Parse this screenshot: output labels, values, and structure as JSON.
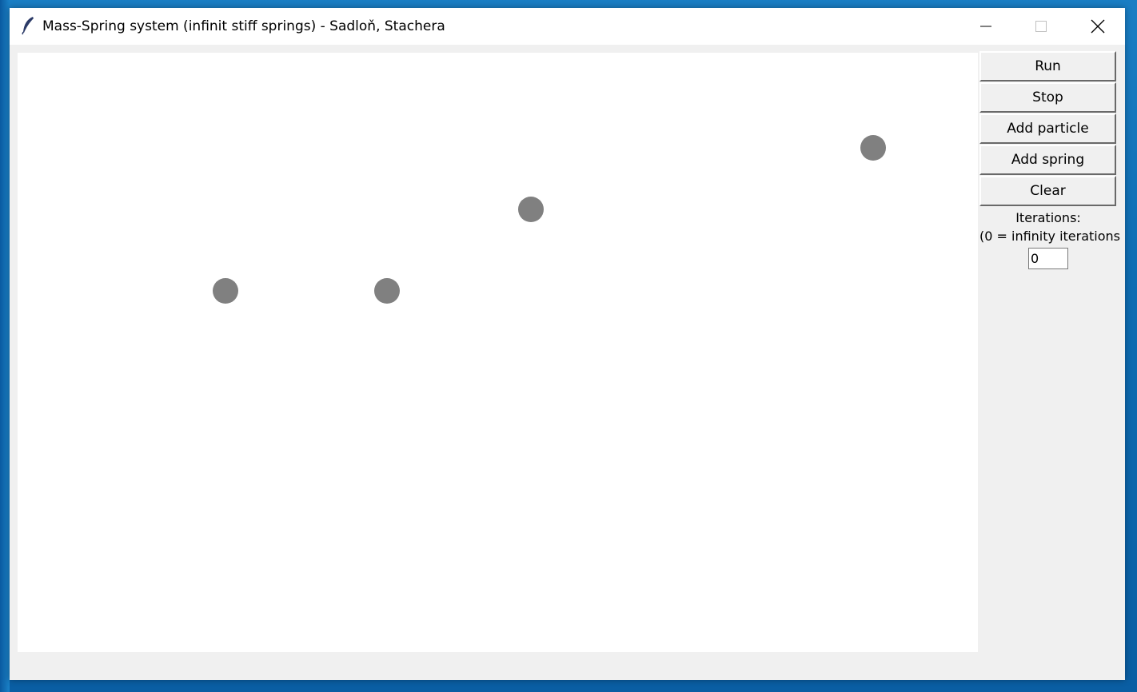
{
  "window": {
    "title": "Mass-Spring system (infinit stiff springs) - Sadloň, Stachera",
    "icon": "feather-icon"
  },
  "controls": {
    "run_label": "Run",
    "stop_label": "Stop",
    "add_particle_label": "Add particle",
    "add_spring_label": "Add spring",
    "clear_label": "Clear"
  },
  "iterations": {
    "label_line1": "Iterations:",
    "label_line2": "(0 = infinity iterations",
    "value": "0"
  },
  "canvas": {
    "particle_color": "#808080",
    "particle_count": 4
  }
}
